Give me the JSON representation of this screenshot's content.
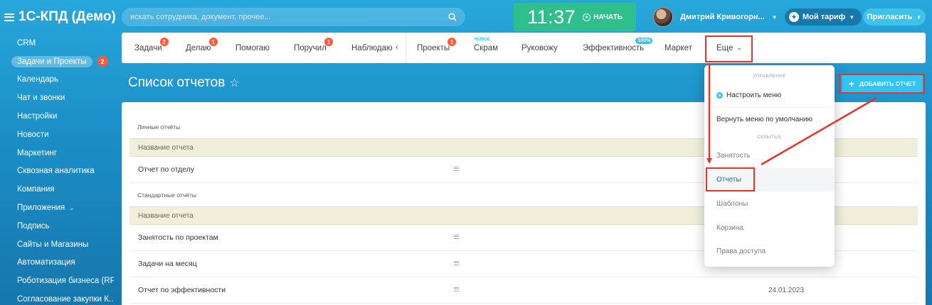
{
  "app": {
    "title": "1С-КПД (Демо)"
  },
  "search": {
    "placeholder": "искать сотрудника, документ, прочее..."
  },
  "clock": {
    "time": "11:37",
    "start_label": "НАЧАТЬ"
  },
  "user": {
    "name": "Дмитрий Кривогорн..."
  },
  "tariff": {
    "label": "Мой тариф"
  },
  "invite": {
    "label": "Пригласить"
  },
  "sidebar": {
    "items": [
      {
        "label": "CRM"
      },
      {
        "label": "Задачи и Проекты",
        "badge": "2"
      },
      {
        "label": "Календарь"
      },
      {
        "label": "Чат и звонки"
      },
      {
        "label": "Настройки"
      },
      {
        "label": "Новости"
      },
      {
        "label": "Маркетинг"
      },
      {
        "label": "Сквозная аналитика"
      },
      {
        "label": "Компания"
      },
      {
        "label": "Приложения"
      },
      {
        "label": "Подпись"
      },
      {
        "label": "Сайты и Магазины"
      },
      {
        "label": "Автоматизация"
      },
      {
        "label": "Роботизация бизнеса (RP..."
      },
      {
        "label": "Согласование закупки К..."
      }
    ]
  },
  "tabs": [
    {
      "label": "Задачи",
      "counter": "2"
    },
    {
      "label": "Делаю",
      "counter": "1"
    },
    {
      "label": "Помогаю"
    },
    {
      "label": "Поручил",
      "counter": "1"
    },
    {
      "label": "Наблюдаю"
    },
    {
      "label": "Проекты",
      "counter": "1"
    },
    {
      "label": "Скрам",
      "tag": "НОВОЕ"
    },
    {
      "label": "Руковожу"
    },
    {
      "label": "Эффективность",
      "tag": "100%"
    },
    {
      "label": "Маркет"
    },
    {
      "label": "Еще"
    }
  ],
  "page": {
    "title": "Список отчетов",
    "add_button": "ДОБАВИТЬ ОТЧЕТ"
  },
  "reports": {
    "personal_label": "Личные отчёты",
    "standard_label": "Стандартные отчёты",
    "column_header": "Название отчета",
    "personal_rows": [
      {
        "name": "Отчет по отделу",
        "date": ""
      }
    ],
    "standard_rows": [
      {
        "name": "Занятость по проектам",
        "date": ""
      },
      {
        "name": "Задачи на месяц",
        "date": ""
      },
      {
        "name": "Отчет по эффективности",
        "date": "24.01.2023"
      }
    ]
  },
  "dropdown": {
    "section_manage": "УПРАВЛЕНИЕ",
    "configure": "Настроить меню",
    "reset": "Вернуть меню по умолчанию",
    "section_hidden": "СКРЫТЫЕ",
    "items": [
      "Занятость",
      "Отчеты",
      "Шаблоны",
      "Корзина",
      "Права доступа"
    ]
  },
  "colors": {
    "accent": "#2fc6f6",
    "annotation": "#e8332b",
    "counter": "#ff5a35",
    "clock": "#2fbf8c"
  }
}
